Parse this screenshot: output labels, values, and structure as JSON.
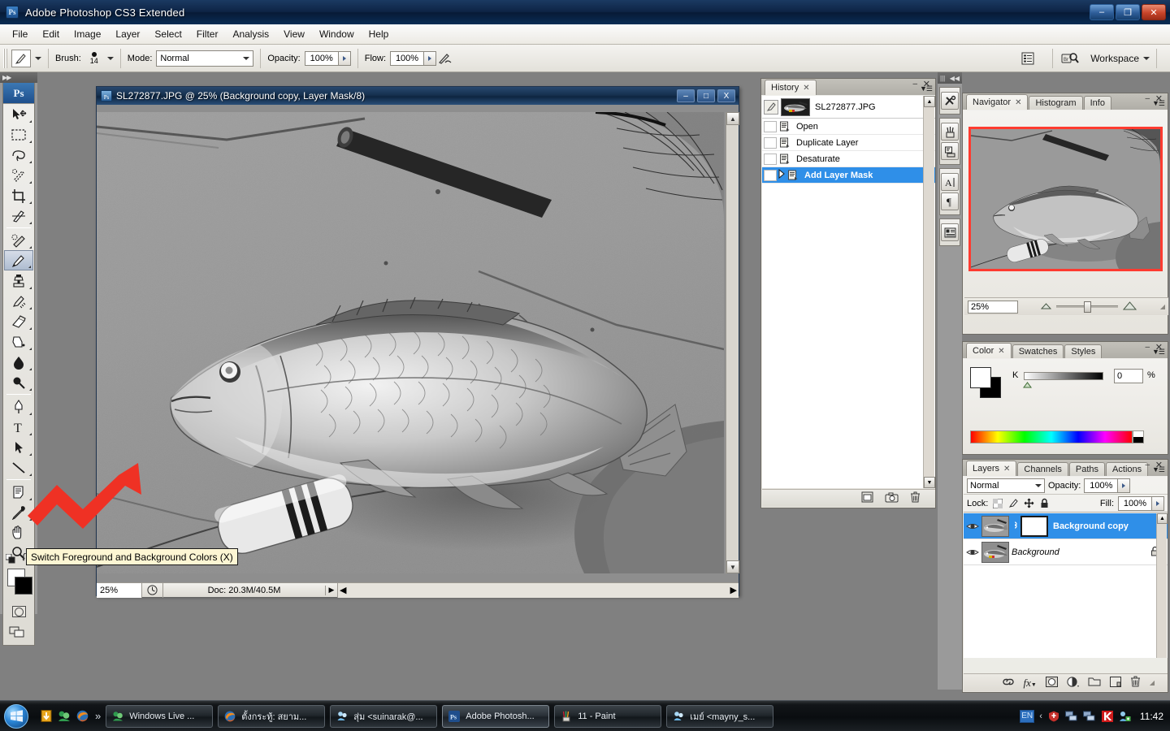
{
  "window": {
    "app_title": "Adobe Photoshop CS3 Extended",
    "app_badge": "Ps",
    "minimize": "–",
    "restore": "❐",
    "close": "✕"
  },
  "menubar": {
    "items": [
      {
        "label": "File"
      },
      {
        "label": "Edit"
      },
      {
        "label": "Image"
      },
      {
        "label": "Layer"
      },
      {
        "label": "Select"
      },
      {
        "label": "Filter"
      },
      {
        "label": "Analysis"
      },
      {
        "label": "View"
      },
      {
        "label": "Window"
      },
      {
        "label": "Help"
      }
    ]
  },
  "options_bar": {
    "brush_label": "Brush:",
    "brush_size": "14",
    "mode_label": "Mode:",
    "mode_value": "Normal",
    "opacity_label": "Opacity:",
    "opacity_value": "100%",
    "flow_label": "Flow:",
    "flow_value": "100%",
    "workspace_label": "Workspace",
    "palette_icon": "palettes-icon",
    "bridge_icon": "bridge-icon",
    "airbrush_icon": "airbrush-icon"
  },
  "toolbox": {
    "badge": "Ps",
    "tools": [
      {
        "name": "move-tool",
        "selected": false
      },
      {
        "name": "rectangular-marquee-tool",
        "selected": false
      },
      {
        "name": "lasso-tool",
        "selected": false
      },
      {
        "name": "quick-selection-tool",
        "selected": false
      },
      {
        "name": "crop-tool",
        "selected": false
      },
      {
        "name": "slice-tool",
        "selected": false
      },
      {
        "name": "healing-brush-tool",
        "selected": false
      },
      {
        "name": "brush-tool",
        "selected": true
      },
      {
        "name": "clone-stamp-tool",
        "selected": false
      },
      {
        "name": "history-brush-tool",
        "selected": false
      },
      {
        "name": "eraser-tool",
        "selected": false
      },
      {
        "name": "gradient-tool",
        "selected": false
      },
      {
        "name": "blur-tool",
        "selected": false
      },
      {
        "name": "dodge-tool",
        "selected": false
      },
      {
        "name": "pen-tool",
        "selected": false
      },
      {
        "name": "horizontal-type-tool",
        "selected": false
      },
      {
        "name": "path-selection-tool",
        "selected": false
      },
      {
        "name": "line-shape-tool",
        "selected": false
      },
      {
        "name": "notes-tool",
        "selected": false
      },
      {
        "name": "eyedropper-tool",
        "selected": false
      },
      {
        "name": "hand-tool",
        "selected": false
      },
      {
        "name": "zoom-tool",
        "selected": false
      }
    ],
    "foreground_color": "#ffffff",
    "background_color": "#000000",
    "quick_mask_name": "quick-mask-button",
    "screen_mode_name": "screen-mode-button"
  },
  "tooltip": {
    "text": "Switch Foreground and Background Colors (X)"
  },
  "document": {
    "title": "SL272877.JPG @ 25% (Background copy, Layer Mask/8)",
    "minimize": "–",
    "maximize": "□",
    "close": "X",
    "status_zoom": "25%",
    "status_doc": "Doc: 20.3M/40.5M",
    "status_arrow": "▶",
    "scroll_left": "◀",
    "scroll_right": "▶",
    "scroll_up": "▲",
    "scroll_down": "▼"
  },
  "dock_strip": {
    "collapse_icon": "collapse-dock-icon",
    "buttons": [
      {
        "name": "tool-presets-icon",
        "glyph": "✂"
      },
      {
        "name": "brushes-icon",
        "glyph": "✒"
      },
      {
        "name": "clone-source-icon",
        "glyph": "⎙"
      },
      {
        "name": "character-icon",
        "glyph": "A"
      },
      {
        "name": "paragraph-icon",
        "glyph": "¶"
      },
      {
        "name": "layer-comps-icon",
        "glyph": "▤"
      }
    ]
  },
  "history_panel": {
    "tab": "History",
    "tab_close": "✕",
    "minimize": "–",
    "close": "✕",
    "snapshot": "SL272877.JPG",
    "states": [
      {
        "label": "Open",
        "active": false
      },
      {
        "label": "Duplicate Layer",
        "active": false
      },
      {
        "label": "Desaturate",
        "active": false
      },
      {
        "label": "Add Layer Mask",
        "active": true
      }
    ],
    "footer_buttons": [
      {
        "name": "new-document-from-state-icon"
      },
      {
        "name": "new-snapshot-icon"
      },
      {
        "name": "delete-state-icon"
      }
    ]
  },
  "navigator_panel": {
    "tabs": [
      {
        "label": "Navigator",
        "active": true
      },
      {
        "label": "Histogram",
        "active": false
      },
      {
        "label": "Info",
        "active": false
      }
    ],
    "tab_close": "✕",
    "minimize": "–",
    "close": "✕",
    "zoom_value": "25%",
    "view_box_color": "#ff3b30",
    "zoom_out_icon": "zoom-out-icon",
    "zoom_in_icon": "zoom-in-icon"
  },
  "color_panel": {
    "tabs": [
      {
        "label": "Color",
        "active": true
      },
      {
        "label": "Swatches",
        "active": false
      },
      {
        "label": "Styles",
        "active": false
      }
    ],
    "tab_close": "✕",
    "minimize": "–",
    "close": "✕",
    "channel_label": "K",
    "channel_value": "0",
    "percent_symbol": "%",
    "foreground_color": "#ffffff",
    "background_color": "#000000"
  },
  "layers_panel": {
    "tabs": [
      {
        "label": "Layers",
        "active": true
      },
      {
        "label": "Channels",
        "active": false
      },
      {
        "label": "Paths",
        "active": false
      },
      {
        "label": "Actions",
        "active": false
      }
    ],
    "tab_close": "✕",
    "minimize": "–",
    "close": "✕",
    "blend_mode": "Normal",
    "opacity_label": "Opacity:",
    "opacity_value": "100%",
    "lock_label": "Lock:",
    "fill_label": "Fill:",
    "fill_value": "100%",
    "lock_icons": [
      {
        "name": "lock-transparent-pixels-icon"
      },
      {
        "name": "lock-image-pixels-icon"
      },
      {
        "name": "lock-position-icon"
      },
      {
        "name": "lock-all-icon"
      }
    ],
    "layers": [
      {
        "name": "Background copy",
        "selected": true,
        "has_mask": true,
        "locked": false,
        "italic": false
      },
      {
        "name": "Background",
        "selected": false,
        "has_mask": false,
        "locked": true,
        "italic": true
      }
    ],
    "footer_buttons": [
      {
        "name": "link-layers-icon",
        "glyph": "⚭"
      },
      {
        "name": "layer-style-icon",
        "glyph": "fx"
      },
      {
        "name": "add-layer-mask-icon",
        "glyph": "▢"
      },
      {
        "name": "adjustment-layer-icon",
        "glyph": "◑"
      },
      {
        "name": "new-group-icon",
        "glyph": "▭"
      },
      {
        "name": "new-layer-icon",
        "glyph": "⧉"
      },
      {
        "name": "delete-layer-icon",
        "glyph": "⌧"
      }
    ]
  },
  "taskbar": {
    "start_label": "start-orb",
    "quick_launch": [
      {
        "name": "download-manager-icon"
      },
      {
        "name": "messenger-icon"
      },
      {
        "name": "firefox-icon"
      }
    ],
    "overflow": "»",
    "tasks": [
      {
        "label": "Windows Live ...",
        "icon": "messenger-icon",
        "active": false
      },
      {
        "label": "ตั้งกระทู้: สยาม...",
        "icon": "firefox-icon",
        "active": false
      },
      {
        "label": "สุ่ม <suinarak@...",
        "icon": "messenger-contact-icon",
        "active": false
      },
      {
        "label": "Adobe Photosh...",
        "icon": "photoshop-icon",
        "active": true
      },
      {
        "label": "11 - Paint",
        "icon": "paint-icon",
        "active": false
      },
      {
        "label": "เมย์ <mayny_s...",
        "icon": "messenger-contact-icon",
        "active": false
      }
    ],
    "tray": {
      "language": "EN",
      "expand": "‹",
      "icons": [
        {
          "name": "security-shield-icon"
        },
        {
          "name": "network-icon"
        },
        {
          "name": "network-2-icon"
        },
        {
          "name": "kaspersky-icon"
        },
        {
          "name": "messenger-tray-icon"
        }
      ],
      "clock": "11:42"
    }
  }
}
